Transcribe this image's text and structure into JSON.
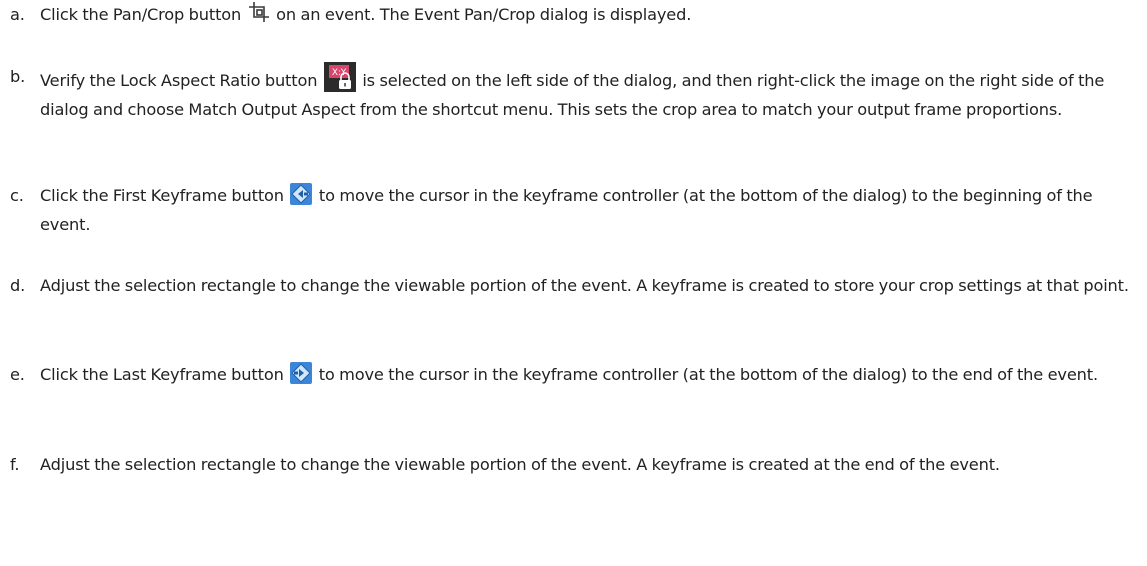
{
  "steps": [
    {
      "marker": "a.",
      "before_icon": "Click the Pan/Crop button",
      "icon": "pan-crop-icon",
      "after_icon": "on an event. The Event Pan/Crop dialog is displayed."
    },
    {
      "marker": "b.",
      "before_icon": "Verify the Lock Aspect Ratio button",
      "icon": "lock-aspect-ratio-icon",
      "after_icon": "is selected on the left side of the dialog, and then right-click the image on the right side of the dialog and choose Match Output Aspect from the shortcut menu. This sets the crop area to match your output frame proportions.",
      "icon_badge": "X:Y"
    },
    {
      "marker": "c.",
      "before_icon": "Click the First Keyframe button",
      "icon": "first-keyframe-icon",
      "after_icon": "to move the cursor in the keyframe controller (at the bottom of the dialog) to the beginning of the event."
    },
    {
      "marker": "d.",
      "text": "Adjust the selection rectangle to change the viewable portion of the event. A keyframe is created to store your crop settings at that point."
    },
    {
      "marker": "e.",
      "before_icon": "Click the Last Keyframe button",
      "icon": "last-keyframe-icon",
      "after_icon": "to move the cursor in the keyframe controller (at the bottom of the dialog) to the end of the event."
    },
    {
      "marker": "f.",
      "text": "Adjust the selection rectangle to change the viewable portion of the event. A keyframe is created at the end of the event."
    }
  ],
  "colors": {
    "text": "#222222",
    "icon_dark": "#3a3a3a",
    "lock_bg": "#2b2b2b",
    "lock_accent": "#d9456a",
    "keyframe_blue": "#2f7fd6",
    "keyframe_light": "#cfe6fb"
  }
}
